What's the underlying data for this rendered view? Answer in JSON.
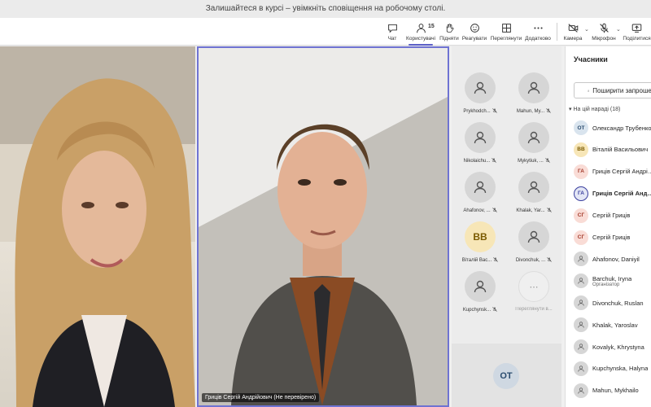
{
  "notice": "Залишайтеся в курсі – увімкніть сповіщення на робочому столі.",
  "toolbar": {
    "chat": "Чат",
    "people": "Користувачі",
    "people_count": "15",
    "raise": "Підняти",
    "react": "Реагувати",
    "view": "Переглянути",
    "more": "Додатково",
    "camera": "Камера",
    "mic": "Мікрофон",
    "share": "Поділитися"
  },
  "videos": {
    "center_label": "Гриців Сергій Андрійович (Не перевірено)"
  },
  "tiles": [
    {
      "name": "Prykhodch...",
      "initials": "",
      "muted": false
    },
    {
      "name": "Mahun, My...",
      "initials": "",
      "muted": false
    },
    {
      "name": "Nikolaichu...",
      "initials": "",
      "muted": false
    },
    {
      "name": "Mykytiuk, ...",
      "initials": "",
      "muted": false
    },
    {
      "name": "Ahafonov, ...",
      "initials": "",
      "muted": false
    },
    {
      "name": "Khalak, Yar...",
      "initials": "",
      "muted": false
    },
    {
      "name": "Віталій Вас...",
      "initials": "ВВ",
      "muted": false
    },
    {
      "name": "Divonchuk, ...",
      "initials": "",
      "muted": false
    },
    {
      "name": "Kupchynsk...",
      "initials": "",
      "muted": false
    },
    {
      "name": "Переглянути в...",
      "initials": "",
      "muted": true
    }
  ],
  "self_tile": {
    "initials": "ОТ"
  },
  "panel": {
    "title": "Учасники",
    "share_button": "Поширити запрошення",
    "section": "На цій нараді (18)",
    "participants": [
      {
        "name": "Олександр Трубенко",
        "initials": "ОТ",
        "sub": "",
        "bg": "#d9e4ee",
        "fg": "#2a4b6e",
        "bold": false
      },
      {
        "name": "Віталій Васильович",
        "initials": "ВВ",
        "sub": "",
        "bg": "#f7e6b7",
        "fg": "#7a5a00",
        "bold": false
      },
      {
        "name": "Гриців Сергій Андрійович",
        "initials": "ГА",
        "sub": "",
        "bg": "#f9dcd6",
        "fg": "#a33a2a",
        "bold": false
      },
      {
        "name": "Гриців Сергій Андрійович",
        "initials": "ГА",
        "sub": "",
        "bg": "#e3e6f5",
        "fg": "#3a3f9e",
        "bold": true
      },
      {
        "name": "Сергій Гриців",
        "initials": "СГ",
        "sub": "",
        "bg": "#f9dcd6",
        "fg": "#a33a2a",
        "bold": false
      },
      {
        "name": "Сергій Гриців",
        "initials": "СГ",
        "sub": "",
        "bg": "#f9dcd6",
        "fg": "#a33a2a",
        "bold": false
      },
      {
        "name": "Ahafonov, Daniyil",
        "initials": "",
        "sub": "",
        "bg": "#d6d6d6",
        "fg": "#555",
        "bold": false
      },
      {
        "name": "Barchuk, Iryna",
        "initials": "",
        "sub": "Організатор",
        "bg": "#d6d6d6",
        "fg": "#555",
        "bold": false
      },
      {
        "name": "Divonchuk, Ruslan",
        "initials": "",
        "sub": "",
        "bg": "#d6d6d6",
        "fg": "#555",
        "bold": false
      },
      {
        "name": "Khalak, Yaroslav",
        "initials": "",
        "sub": "",
        "bg": "#d6d6d6",
        "fg": "#555",
        "bold": false
      },
      {
        "name": "Kovalyk, Khrystyna",
        "initials": "",
        "sub": "",
        "bg": "#d6d6d6",
        "fg": "#555",
        "bold": false
      },
      {
        "name": "Kupchynska, Halyna",
        "initials": "",
        "sub": "",
        "bg": "#d6d6d6",
        "fg": "#555",
        "bold": false
      },
      {
        "name": "Mahun, Mykhailo",
        "initials": "",
        "sub": "",
        "bg": "#d6d6d6",
        "fg": "#555",
        "bold": false
      }
    ]
  }
}
